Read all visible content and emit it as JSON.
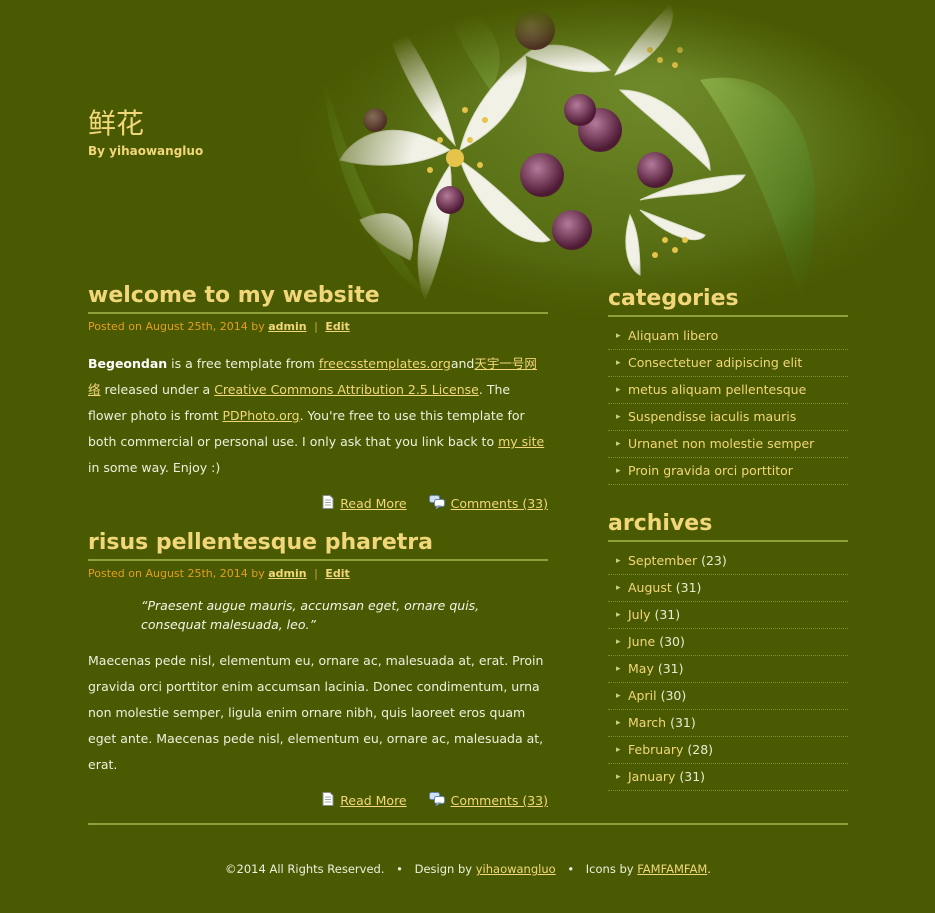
{
  "site": {
    "title": "鲜花",
    "byline": "By yihaowangluo"
  },
  "posts": [
    {
      "title": "welcome to my website",
      "meta_prefix": "Posted on August 25th, 2014 by",
      "author": "admin",
      "sep": "|",
      "edit": "Edit",
      "body": {
        "strong": "Begeondan",
        "t1": " is a free template from ",
        "link1": "freecsstemplates.org",
        "t2": "and",
        "link2": "天宇一号网络",
        "t3": " released under a ",
        "link3": "Creative Commons Attribution 2.5 License",
        "t4": ". The flower photo is fromt ",
        "link4": "PDPhoto.org",
        "t5": ". You're free to use this template for both commercial or personal use. I only ask that you link back to ",
        "link5": "my site",
        "t6": " in some way. Enjoy :)"
      },
      "read_more": "Read More",
      "comments": "Comments (33)"
    },
    {
      "title": "risus pellentesque pharetra",
      "meta_prefix": "Posted on August 25th, 2014 by",
      "author": "admin",
      "sep": "|",
      "edit": "Edit",
      "quote": "“Praesent augue mauris, accumsan eget, ornare quis, consequat malesuada, leo.”",
      "paragraph": "Maecenas pede nisl, elementum eu, ornare ac, malesuada at, erat. Proin gravida orci porttitor enim accumsan lacinia. Donec condimentum, urna non molestie semper, ligula enim ornare nibh, quis laoreet eros quam eget ante. Maecenas pede nisl, elementum eu, ornare ac, malesuada at, erat.",
      "read_more": "Read More",
      "comments": "Comments (33)"
    }
  ],
  "sidebar": {
    "categories_title": "categories",
    "categories": [
      "Aliquam libero",
      "Consectetuer adipiscing elit",
      "metus aliquam pellentesque",
      "Suspendisse iaculis mauris",
      "Urnanet non molestie semper",
      "Proin gravida orci porttitor"
    ],
    "archives_title": "archives",
    "archives": [
      {
        "month": "September",
        "count": "(23)"
      },
      {
        "month": "August",
        "count": "(31)"
      },
      {
        "month": "July",
        "count": "(31)"
      },
      {
        "month": "June",
        "count": "(30)"
      },
      {
        "month": "May",
        "count": "(31)"
      },
      {
        "month": "April",
        "count": "(30)"
      },
      {
        "month": "March",
        "count": "(31)"
      },
      {
        "month": "February",
        "count": "(28)"
      },
      {
        "month": "January",
        "count": "(31)"
      }
    ]
  },
  "footer": {
    "copyright": "©2014 All Rights Reserved.",
    "bullet": "•",
    "design_by": "Design by",
    "designer": "yihaowangluo",
    "icons_by": "Icons by",
    "icons_source": "FAMFAMFAM",
    "end": "."
  },
  "colors": {
    "background": "#4a5a02",
    "accent": "#f2d77a",
    "meta": "#e59e1e",
    "rule": "#8ea03a"
  },
  "icons": {
    "read_more": "page-icon",
    "comments": "comments-icon",
    "list_bullet": "triangle-bullet-icon"
  }
}
